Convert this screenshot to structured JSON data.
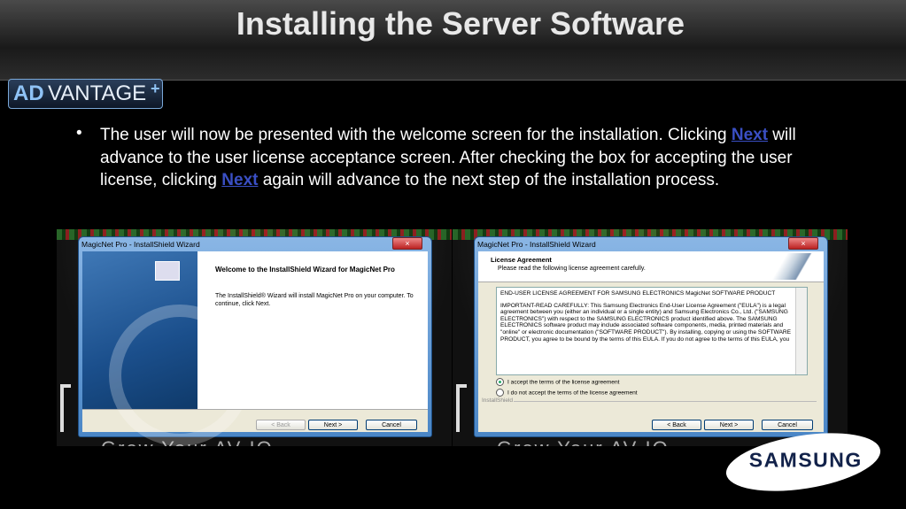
{
  "slide": {
    "title": "Installing the Server Software",
    "logo": {
      "part1": "AD",
      "part2": "VANTAGE",
      "plus": "+"
    },
    "bullet": "•",
    "paragraph": {
      "seg1": "The user will now be presented with the welcome screen for the installation. Clicking ",
      "link1": "Next",
      "seg2": " will advance to the user license acceptance screen. After checking the box for accepting the user license, clicking ",
      "link2": "Next",
      "seg3": " again will advance to the next step of the installation process."
    },
    "brand": "SAMSUNG",
    "background_text": "Grow Your AV IQ"
  },
  "screenshot1": {
    "window_title": "MagicNet Pro - InstallShield Wizard",
    "close": "×",
    "heading": "Welcome to the InstallShield Wizard for MagicNet Pro",
    "body": "The InstallShield® Wizard will install MagicNet Pro on your computer.  To continue, click Next.",
    "buttons": {
      "back": "< Back",
      "next": "Next >",
      "cancel": "Cancel"
    }
  },
  "screenshot2": {
    "window_title": "MagicNet Pro - InstallShield Wizard",
    "close": "×",
    "header_title": "License Agreement",
    "header_sub": "Please read the following license agreement carefully.",
    "license_line1": "END-USER LICENSE AGREEMENT FOR SAMSUNG ELECTRONICS MagicNet SOFTWARE PRODUCT",
    "license_line2": "IMPORTANT-READ CAREFULLY: This Samsung Electronics End-User License Agreement (\"EULA\") is a legal agreement between you (either an individual or a single entity) and Samsung Electronics Co., Ltd. (\"SAMSUNG ELECTRONICS\") with respect to the SAMSUNG ELECTRONICS product identified above. The SAMSUNG ELECTRONICS software product may include associated software components, media, printed materials and \"online\" or electronic documentation (\"SOFTWARE PRODUCT\"). By installing, copying or using the SOFTWARE PRODUCT, you agree to be bound by the terms of this EULA. If you do not agree to the terms of this EULA, you",
    "accept": "I accept the terms of the license agreement",
    "decline": "I do not accept the terms of the license agreement",
    "installshield": "InstallShield",
    "buttons": {
      "back": "< Back",
      "next": "Next >",
      "cancel": "Cancel"
    }
  }
}
